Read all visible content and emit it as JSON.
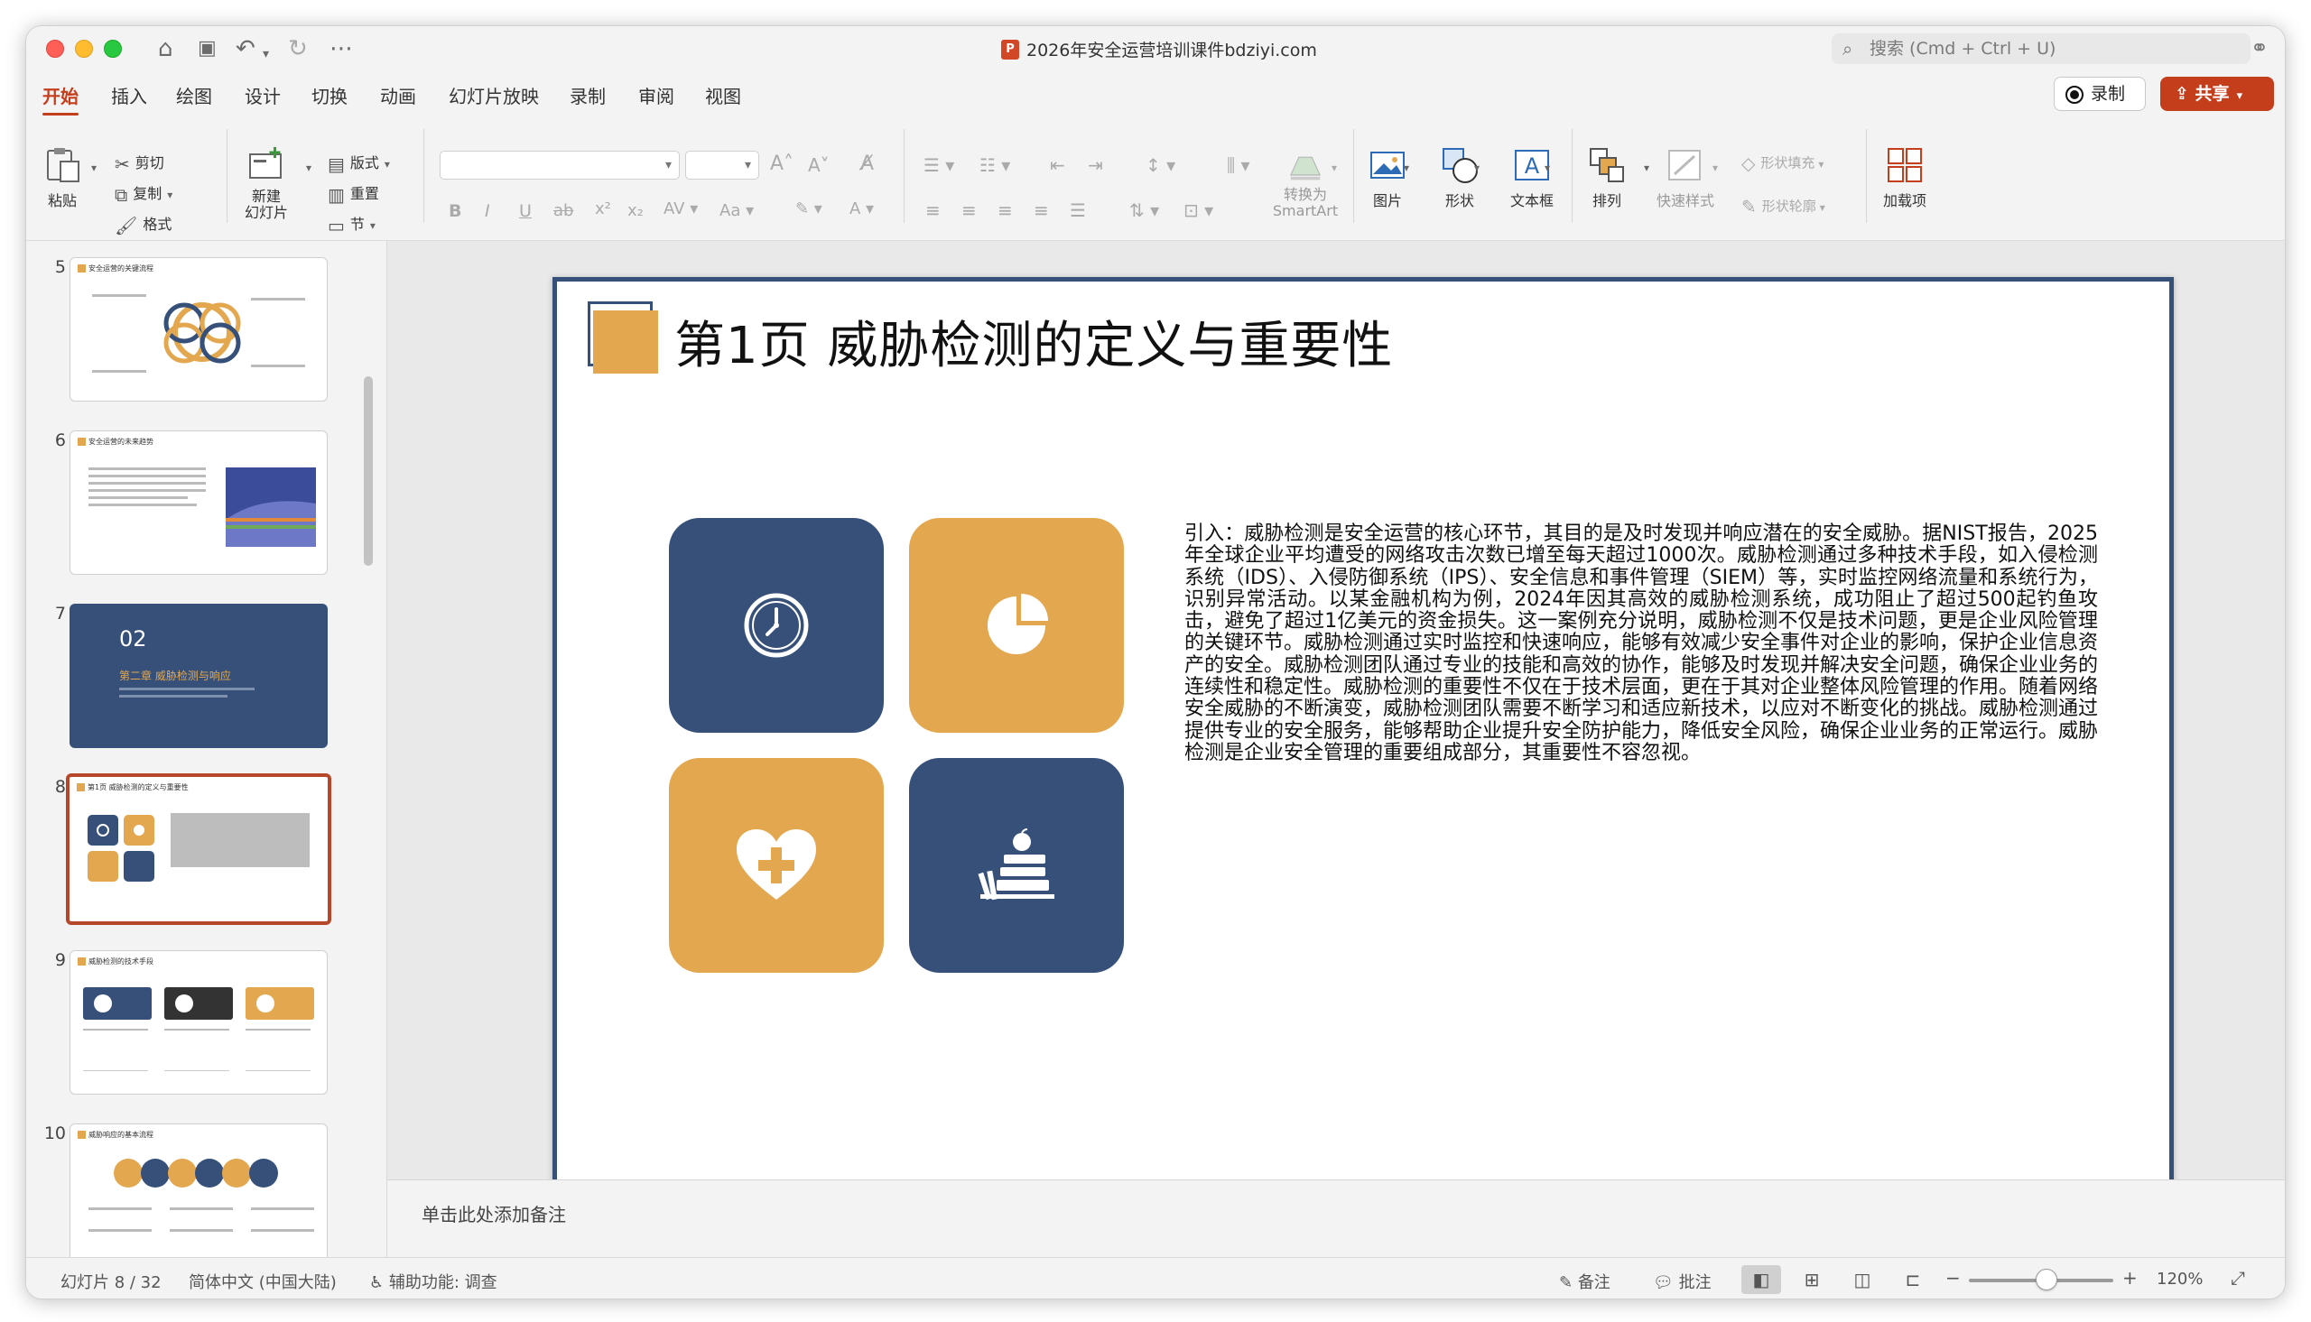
{
  "window": {
    "title": "2026年安全运营培训课件bdziyi.com",
    "search_placeholder": "搜索 (Cmd + Ctrl + U)"
  },
  "tabs": [
    "开始",
    "插入",
    "绘图",
    "设计",
    "切换",
    "动画",
    "幻灯片放映",
    "录制",
    "审阅",
    "视图"
  ],
  "active_tab": "开始",
  "header_buttons": {
    "record": "录制",
    "share": "共享"
  },
  "ribbon": {
    "paste": "粘贴",
    "cut": "剪切",
    "copy": "复制",
    "format": "格式",
    "new_slide": "新建\n幻灯片",
    "layout": "版式",
    "reset": "重置",
    "section": "节",
    "convert_smartart": "转换为\nSmartArt",
    "picture": "图片",
    "shape": "形状",
    "textbox": "文本框",
    "arrange": "排列",
    "quick_styles": "快速样式",
    "shape_fill": "形状填充",
    "shape_outline": "形状轮廓",
    "addins": "加载项"
  },
  "thumbnails": [
    {
      "num": "5",
      "title": "安全运营的关键流程"
    },
    {
      "num": "6",
      "title": "安全运营的未来趋势"
    },
    {
      "num": "7",
      "chapter_no": "02",
      "chapter_title": "第二章 威胁检测与响应"
    },
    {
      "num": "8",
      "title": "第1页 威胁检测的定义与重要性",
      "selected": true
    },
    {
      "num": "9",
      "title": "威胁检测的技术手段"
    },
    {
      "num": "10",
      "title": "威胁响应的基本流程"
    }
  ],
  "slide": {
    "title": "第1页 威胁检测的定义与重要性",
    "body": "引入：威胁检测是安全运营的核心环节，其目的是及时发现并响应潜在的安全威胁。据NIST报告，2025年全球企业平均遭受的网络攻击次数已增至每天超过1000次。威胁检测通过多种技术手段，如入侵检测系统（IDS）、入侵防御系统（IPS）、安全信息和事件管理（SIEM）等，实时监控网络流量和系统行为，识别异常活动。以某金融机构为例，2024年因其高效的威胁检测系统，成功阻止了超过500起钓鱼攻击，避免了超过1亿美元的资金损失。这一案例充分说明，威胁检测不仅是技术问题，更是企业风险管理的关键环节。威胁检测通过实时监控和快速响应，能够有效减少安全事件对企业的影响，保护企业信息资产的安全。威胁检测团队通过专业的技能和高效的协作，能够及时发现并解决安全问题，确保企业业务的连续性和稳定性。威胁检测的重要性不仅在于技术层面，更在于其对企业整体风险管理的作用。随着网络安全威胁的不断演变，威胁检测团队需要不断学习和适应新技术，以应对不断变化的挑战。威胁检测通过提供专业的安全服务，能够帮助企业提升安全防护能力，降低安全风险，确保企业业务的正常运行。威胁检测是企业安全管理的重要组成部分，其重要性不容忽视。",
    "colors": {
      "blue": "#36507a",
      "gold": "#e3a84f"
    },
    "tiles": [
      {
        "color": "blue",
        "icon": "clock-icon"
      },
      {
        "color": "gold",
        "icon": "pie-chart-icon"
      },
      {
        "color": "gold",
        "icon": "heart-plus-icon"
      },
      {
        "color": "blue",
        "icon": "books-apple-icon"
      }
    ]
  },
  "notes_placeholder": "单击此处添加备注",
  "status": {
    "slide_counter": "幻灯片 8 / 32",
    "language": "简体中文 (中国大陆)",
    "accessibility": "辅助功能: 调查",
    "notes": "备注",
    "comments": "批注",
    "zoom": "120%",
    "zoom_level_percent": 120
  },
  "accent_color": "#c43e1c"
}
